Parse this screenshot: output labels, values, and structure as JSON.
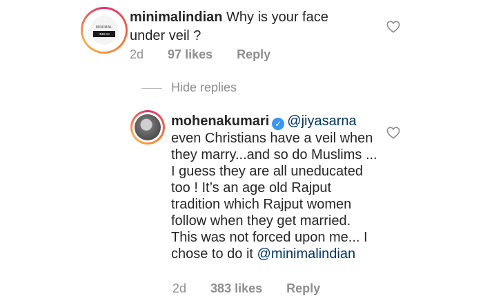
{
  "comment1": {
    "username": "minimalindian",
    "avatar_logo_text": "MINIMAL",
    "avatar_logo_bar": "INDIAN",
    "text": "Why is your face under veil ?",
    "time": "2d",
    "likes": "97 likes",
    "reply": "Reply"
  },
  "hide_replies": "Hide replies",
  "comment2": {
    "username": "mohenakumari",
    "mention": "@jiyasarna",
    "text": "even Christians have a veil when they marry...and so do Muslims ... I guess they are all uneducated too ! It’s an age old Rajput  tradition which Rajput women follow when they get married. This was not forced upon me... I chose to do it",
    "mention_end": "@minimalindian",
    "time": "2d",
    "likes": "383 likes",
    "reply": "Reply"
  },
  "icons": {
    "like": "heart-outline-icon",
    "verified": "verified-badge-icon"
  },
  "colors": {
    "text": "#262626",
    "muted": "#8e8e8e",
    "mention": "#003569",
    "verified": "#3897f0"
  }
}
